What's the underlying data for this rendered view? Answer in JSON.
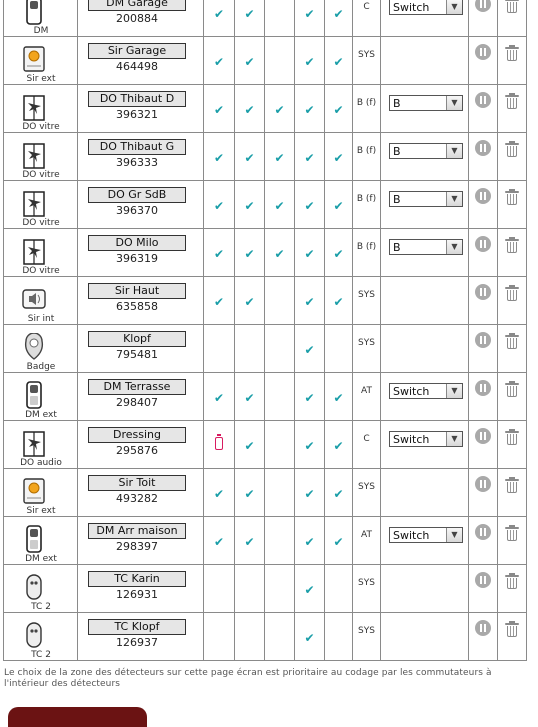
{
  "rows": [
    {
      "type": "DM",
      "name": "DM Garage",
      "id": "200884",
      "icon": "motion-detector-icon",
      "checks": [
        true,
        true,
        false,
        true,
        true
      ],
      "battery": false,
      "zone": "C",
      "select": "Switch"
    },
    {
      "type": "Sir ext",
      "name": "Sir Garage",
      "id": "464498",
      "icon": "outdoor-siren-icon",
      "checks": [
        true,
        true,
        false,
        true,
        true
      ],
      "battery": false,
      "zone": "SYS",
      "select": null
    },
    {
      "type": "DO vitre",
      "name": "DO Thibaut D",
      "id": "396321",
      "icon": "window-glass-detector-icon",
      "checks": [
        true,
        true,
        true,
        true,
        true
      ],
      "battery": false,
      "zone": "B (f)",
      "select": "B"
    },
    {
      "type": "DO vitre",
      "name": "DO Thibaut G",
      "id": "396333",
      "icon": "window-glass-detector-icon",
      "checks": [
        true,
        true,
        true,
        true,
        true
      ],
      "battery": false,
      "zone": "B (f)",
      "select": "B"
    },
    {
      "type": "DO vitre",
      "name": "DO Gr SdB",
      "id": "396370",
      "icon": "window-glass-detector-icon",
      "checks": [
        true,
        true,
        true,
        true,
        true
      ],
      "battery": false,
      "zone": "B (f)",
      "select": "B"
    },
    {
      "type": "DO vitre",
      "name": "DO Milo",
      "id": "396319",
      "icon": "window-glass-detector-icon",
      "checks": [
        true,
        true,
        true,
        true,
        true
      ],
      "battery": false,
      "zone": "B (f)",
      "select": "B"
    },
    {
      "type": "Sir int",
      "name": "Sir Haut",
      "id": "635858",
      "icon": "indoor-siren-icon",
      "checks": [
        true,
        true,
        false,
        true,
        true
      ],
      "battery": false,
      "zone": "SYS",
      "select": null
    },
    {
      "type": "Badge",
      "name": "Klopf",
      "id": "795481",
      "icon": "badge-icon",
      "checks": [
        false,
        false,
        false,
        true,
        false
      ],
      "battery": false,
      "zone": "SYS",
      "select": null
    },
    {
      "type": "DM ext",
      "name": "DM Terrasse",
      "id": "298407",
      "icon": "outdoor-motion-detector-icon",
      "checks": [
        true,
        true,
        false,
        true,
        true
      ],
      "battery": false,
      "zone": "AT",
      "select": "Switch"
    },
    {
      "type": "DO audio",
      "name": "Dressing",
      "id": "295876",
      "icon": "audio-detector-icon",
      "checks": [
        false,
        true,
        false,
        true,
        true
      ],
      "battery": true,
      "zone": "C",
      "select": "Switch"
    },
    {
      "type": "Sir ext",
      "name": "Sir Toit",
      "id": "493282",
      "icon": "outdoor-siren-icon",
      "checks": [
        true,
        true,
        false,
        true,
        true
      ],
      "battery": false,
      "zone": "SYS",
      "select": null
    },
    {
      "type": "DM ext",
      "name": "DM Arr maison",
      "id": "298397",
      "icon": "outdoor-motion-detector-icon",
      "checks": [
        true,
        true,
        false,
        true,
        true
      ],
      "battery": false,
      "zone": "AT",
      "select": "Switch"
    },
    {
      "type": "TC 2",
      "name": "TC Karin",
      "id": "126931",
      "icon": "remote-control-icon",
      "checks": [
        false,
        false,
        false,
        true,
        false
      ],
      "battery": false,
      "zone": "SYS",
      "select": null
    },
    {
      "type": "TC 2",
      "name": "TC Klopf",
      "id": "126937",
      "icon": "remote-control-icon",
      "checks": [
        false,
        false,
        false,
        true,
        false
      ],
      "battery": false,
      "zone": "SYS",
      "select": null
    }
  ],
  "note": "Le choix de la zone des détecteurs sur cette page écran est prioritaire au codage par les commutateurs à l'intérieur des détecteurs",
  "colors": {
    "check": "#1a9ea8",
    "battery": "#d81b60",
    "button": "#6b1313",
    "border": "#8a8a8a"
  }
}
